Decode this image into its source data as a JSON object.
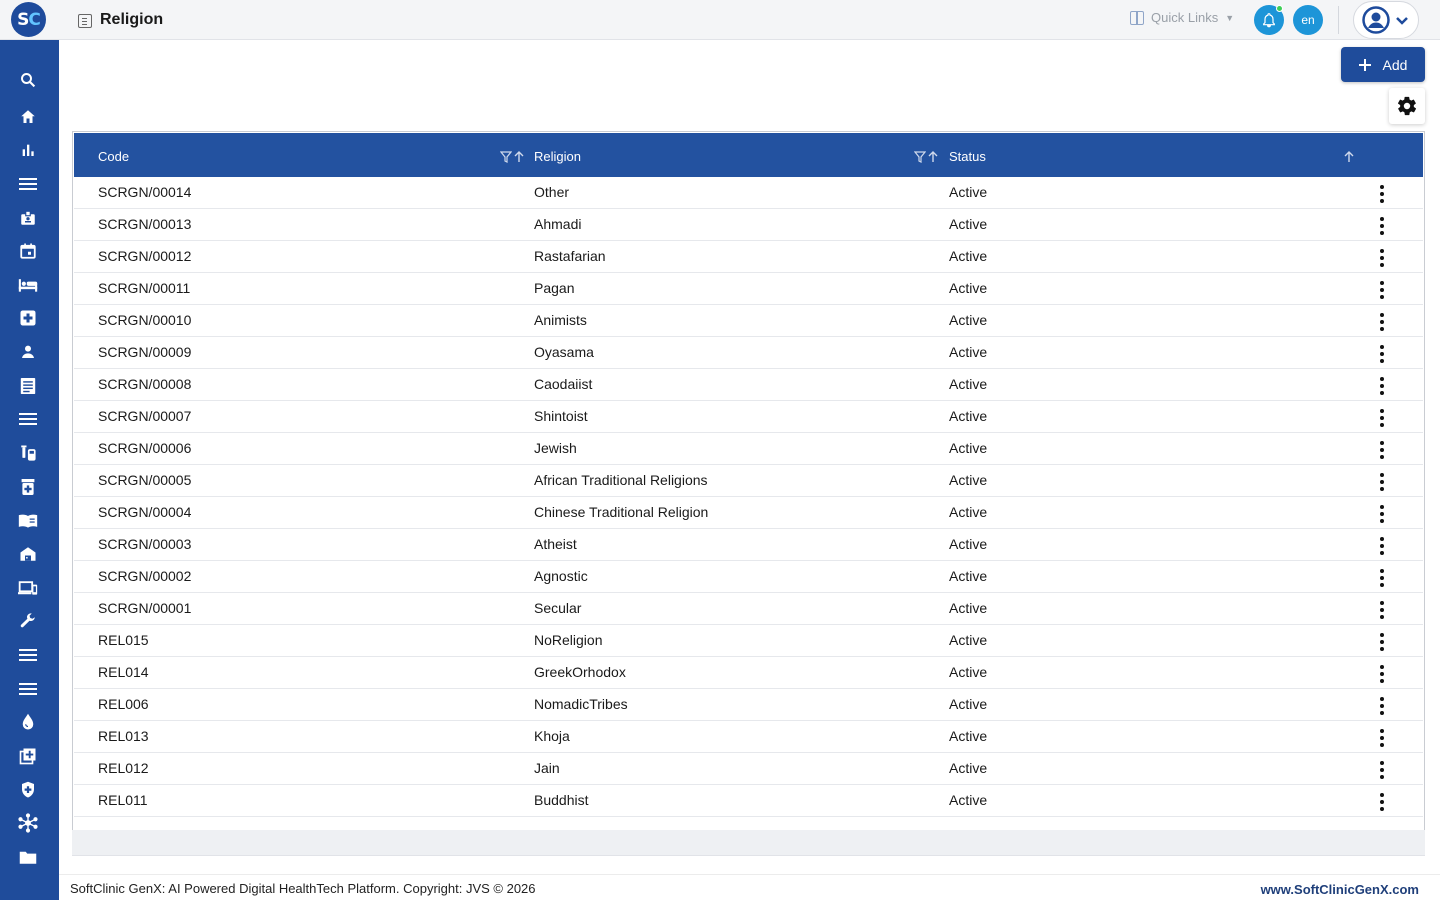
{
  "header": {
    "logo_text_s": "S",
    "logo_text_c": "C",
    "page_title": "Religion",
    "quick_links_label": "Quick Links",
    "language": "en"
  },
  "toolbar": {
    "add_label": "Add"
  },
  "table": {
    "columns": [
      "Code",
      "Religion",
      "Status"
    ],
    "rows": [
      {
        "code": "SCRGN/00014",
        "religion": "Other",
        "status": "Active"
      },
      {
        "code": "SCRGN/00013",
        "religion": "Ahmadi",
        "status": "Active"
      },
      {
        "code": "SCRGN/00012",
        "religion": "Rastafarian",
        "status": "Active"
      },
      {
        "code": "SCRGN/00011",
        "religion": "Pagan",
        "status": "Active"
      },
      {
        "code": "SCRGN/00010",
        "religion": "Animists",
        "status": "Active"
      },
      {
        "code": "SCRGN/00009",
        "religion": "Oyasama",
        "status": "Active"
      },
      {
        "code": "SCRGN/00008",
        "religion": "Caodaiist",
        "status": "Active"
      },
      {
        "code": "SCRGN/00007",
        "religion": "Shintoist",
        "status": "Active"
      },
      {
        "code": "SCRGN/00006",
        "religion": "Jewish",
        "status": "Active"
      },
      {
        "code": "SCRGN/00005",
        "religion": "African Traditional Religions",
        "status": "Active"
      },
      {
        "code": "SCRGN/00004",
        "religion": "Chinese Traditional Religion",
        "status": "Active"
      },
      {
        "code": "SCRGN/00003",
        "religion": "Atheist",
        "status": "Active"
      },
      {
        "code": "SCRGN/00002",
        "religion": "Agnostic",
        "status": "Active"
      },
      {
        "code": "SCRGN/00001",
        "religion": "Secular",
        "status": "Active"
      },
      {
        "code": "REL015",
        "religion": "NoReligion",
        "status": "Active"
      },
      {
        "code": "REL014",
        "religion": "GreekOrhodox",
        "status": "Active"
      },
      {
        "code": "REL006",
        "religion": "NomadicTribes",
        "status": "Active"
      },
      {
        "code": "REL013",
        "religion": "Khoja",
        "status": "Active"
      },
      {
        "code": "REL012",
        "religion": "Jain",
        "status": "Active"
      },
      {
        "code": "REL011",
        "religion": "Buddhist",
        "status": "Active"
      }
    ]
  },
  "sidebar": {
    "icons": [
      "search-icon",
      "home-icon",
      "analytics-icon",
      "menu-icon",
      "badge-icon",
      "calendar-icon",
      "bed-icon",
      "medical-plus-icon",
      "person-icon",
      "document-icon",
      "list-icon",
      "lab-icon",
      "pharmacy-icon",
      "book-icon",
      "store-icon",
      "devices-icon",
      "wrench-icon",
      "lines-icon",
      "hamburger-icon",
      "blood-drop-icon",
      "add-box-icon",
      "shield-icon",
      "hub-icon",
      "folder-icon"
    ]
  },
  "footer": {
    "copyright": "SoftClinic GenX: AI Powered Digital HealthTech Platform. Copyright: JVS © 2026",
    "website": "www.SoftClinicGenX.com"
  },
  "colors": {
    "brand": "#1f4c9b",
    "header_row": "#2352a0",
    "notification": "#1d95d8",
    "online_dot": "#3ecf57"
  }
}
